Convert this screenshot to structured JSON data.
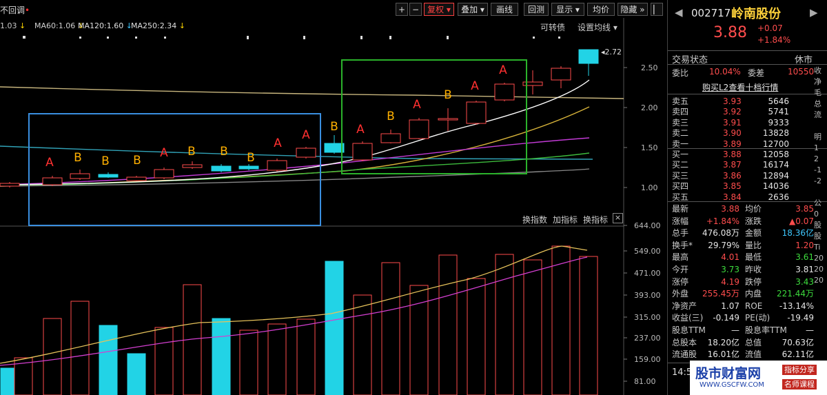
{
  "app": {
    "title_fragment": "不回调"
  },
  "toolbar": {
    "plus": "+",
    "minus": "−",
    "restore": "复权",
    "overlay": "叠加",
    "draw": "画线",
    "review": "回测",
    "display": "显示",
    "average": "均价",
    "hide": "隐藏"
  },
  "ma_legend": [
    "1.03",
    "MA60:1.06",
    "MA120:1.60",
    "MA250:2.34"
  ],
  "chart_header": {
    "swap": "可转债",
    "settings": "设置均线"
  },
  "price_axis": [
    "2.50",
    "2.00",
    "1.50",
    "1.00"
  ],
  "max_price_label": "2.72",
  "volume_axis": [
    "644.00",
    "549.00",
    "471.00",
    "393.00",
    "315.00",
    "237.00",
    "159.00",
    "81.00"
  ],
  "indicator_bar": {
    "swap": "换指数",
    "add": "加指标",
    "change": "换指标",
    "close": "×"
  },
  "annotations": [
    "A",
    "B",
    "B",
    "B",
    "A",
    "B",
    "B",
    "B",
    "A",
    "A",
    "B",
    "A",
    "B",
    "A",
    "B",
    "A",
    "A"
  ],
  "stock": {
    "code": "002717",
    "name": "岭南股份",
    "price": "3.88",
    "change": "+0.07",
    "change_pct": "+1.84%"
  },
  "trade_status": {
    "label": "交易状态",
    "value": "休市"
  },
  "commission": {
    "ratio_label": "委比",
    "ratio": "10.04%",
    "diff_label": "委差",
    "diff": "10550"
  },
  "l2_link": "购买L2查看十档行情",
  "sell_orders": [
    {
      "label": "卖五",
      "price": "3.93",
      "vol": "5646"
    },
    {
      "label": "卖四",
      "price": "3.92",
      "vol": "5741"
    },
    {
      "label": "卖三",
      "price": "3.91",
      "vol": "9333"
    },
    {
      "label": "卖二",
      "price": "3.90",
      "vol": "13828"
    },
    {
      "label": "卖一",
      "price": "3.89",
      "vol": "12700"
    }
  ],
  "buy_orders": [
    {
      "label": "买一",
      "price": "3.88",
      "vol": "12058"
    },
    {
      "label": "买二",
      "price": "3.87",
      "vol": "16174"
    },
    {
      "label": "买三",
      "price": "3.86",
      "vol": "12894"
    },
    {
      "label": "买四",
      "price": "3.85",
      "vol": "14036"
    },
    {
      "label": "买五",
      "price": "3.84",
      "vol": "2636"
    }
  ],
  "stats": [
    {
      "l1": "最新",
      "v1": "3.88",
      "l2": "均价",
      "v2": "3.85",
      "c1": "#ff4d4d",
      "c2": "#ff4d4d"
    },
    {
      "l1": "涨幅",
      "v1": "+1.84%",
      "l2": "涨跌",
      "v2": "▲0.07",
      "c1": "#ff4d4d",
      "c2": "#ff4d4d"
    },
    {
      "l1": "总手",
      "v1": "476.08万",
      "l2": "金额",
      "v2": "18.36亿",
      "c1": "#e6e6e6",
      "c2": "#3ec8ff"
    },
    {
      "l1": "换手*",
      "v1": "29.79%",
      "l2": "量比",
      "v2": "1.20",
      "c1": "#e6e6e6",
      "c2": "#ff4d4d"
    },
    {
      "l1": "最高",
      "v1": "4.01",
      "l2": "最低",
      "v2": "3.61",
      "c1": "#ff4d4d",
      "c2": "#3ddc3d"
    },
    {
      "l1": "今开",
      "v1": "3.73",
      "l2": "昨收",
      "v2": "3.81",
      "c1": "#3ddc3d",
      "c2": "#e6e6e6"
    },
    {
      "l1": "涨停",
      "v1": "4.19",
      "l2": "跌停",
      "v2": "3.43",
      "c1": "#ff4d4d",
      "c2": "#3ddc3d"
    },
    {
      "l1": "外盘",
      "v1": "255.45万",
      "l2": "内盘",
      "v2": "221.44万",
      "c1": "#ff4d4d",
      "c2": "#3ddc3d"
    },
    {
      "l1": "净资产",
      "v1": "1.07",
      "l2": "ROE",
      "v2": "-13.14%",
      "c1": "#e6e6e6",
      "c2": "#e6e6e6"
    },
    {
      "l1": "收益(三)",
      "v1": "-0.149",
      "l2": "PE(动)",
      "v2": "-19.49",
      "c1": "#e6e6e6",
      "c2": "#e6e6e6"
    },
    {
      "l1": "股息TTM",
      "v1": "—",
      "l2": "股息率TTM",
      "v2": "—",
      "c1": "#e6e6e6",
      "c2": "#e6e6e6"
    },
    {
      "l1": "总股本",
      "v1": "18.20亿",
      "l2": "总值",
      "v2": "70.63亿",
      "c1": "#e6e6e6",
      "c2": "#e6e6e6"
    },
    {
      "l1": "流通股",
      "v1": "16.01亿",
      "l2": "流值",
      "v2": "62.11亿",
      "c1": "#e6e6e6",
      "c2": "#e6e6e6"
    }
  ],
  "bottom_time": "14:5",
  "watermark": {
    "site": "股市财富网",
    "url": "WWW.GSCFW.COM",
    "tag1": "指标分享",
    "tag2": "名师课程"
  },
  "colors": {
    "up": "#ff4d4d",
    "down": "#22d3e6",
    "blue_box": "#3a8fe0",
    "green_box": "#2bb32b",
    "annotation_a": "#ff3030",
    "annotation_b": "#ffb000"
  }
}
